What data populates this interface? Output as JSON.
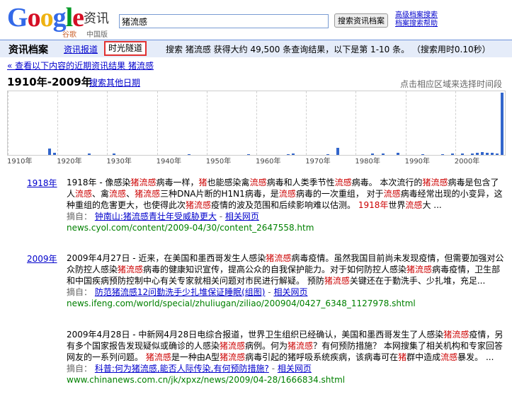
{
  "logo": {
    "text": "Google",
    "cn": "谷歌",
    "region": "中国版"
  },
  "product": "资讯",
  "search": {
    "value": "猪流感",
    "button": "搜索资讯档案",
    "adv1": "高级档案搜索",
    "adv2": "档案搜索帮助"
  },
  "bar": {
    "title": "资讯档案",
    "tab_news": "资讯报道",
    "tab_timeline": "时光隧道",
    "stats": "搜索 猪流感 获得大约 49,500 条查询结果，以下是第 1-10 条。 （搜索用时0.10秒）"
  },
  "back_link": "« 查看以下内容的近期资讯结果 猪流感",
  "range": {
    "label": "1910年-2009年",
    "other": "搜索其他日期",
    "hint": "点击相应区域来选择时间段"
  },
  "chart_data": {
    "type": "bar",
    "x_ticks": [
      "1910年",
      "1920年",
      "1930年",
      "1940年",
      "1950年",
      "1960年",
      "1970年",
      "1980年",
      "1990年",
      "2000年"
    ],
    "bars": [
      {
        "year": 1918,
        "value": 10
      },
      {
        "year": 1919,
        "value": 3
      },
      {
        "year": 1926,
        "value": 2
      },
      {
        "year": 1931,
        "value": 2
      },
      {
        "year": 1946,
        "value": 1
      },
      {
        "year": 1958,
        "value": 1
      },
      {
        "year": 1966,
        "value": 1
      },
      {
        "year": 1967,
        "value": 2
      },
      {
        "year": 1974,
        "value": 1
      },
      {
        "year": 1976,
        "value": 11
      },
      {
        "year": 1983,
        "value": 2
      },
      {
        "year": 1985,
        "value": 2
      },
      {
        "year": 1988,
        "value": 3
      },
      {
        "year": 1993,
        "value": 1
      },
      {
        "year": 1997,
        "value": 1
      },
      {
        "year": 1999,
        "value": 2
      },
      {
        "year": 2001,
        "value": 2
      },
      {
        "year": 2003,
        "value": 2
      },
      {
        "year": 2004,
        "value": 3
      },
      {
        "year": 2005,
        "value": 4
      },
      {
        "year": 2006,
        "value": 3
      },
      {
        "year": 2007,
        "value": 3
      },
      {
        "year": 2008,
        "value": 2
      },
      {
        "year": 2009,
        "value": 100
      }
    ]
  },
  "results": [
    {
      "year": "1918年",
      "segments": [
        {
          "t": "1918年 - 像感染"
        },
        {
          "t": "猪流感",
          "h": true
        },
        {
          "t": "病毒一样，"
        },
        {
          "t": "猪",
          "h": true
        },
        {
          "t": "也能感染禽"
        },
        {
          "t": "流感",
          "h": true
        },
        {
          "t": "病毒和人类季节性"
        },
        {
          "t": "流感",
          "h": true
        },
        {
          "t": "病毒。 本次流行的"
        },
        {
          "t": "猪流感",
          "h": true
        },
        {
          "t": "病毒是包含了人"
        },
        {
          "t": "流感",
          "h": true
        },
        {
          "t": "、禽"
        },
        {
          "t": "流感",
          "h": true
        },
        {
          "t": "、"
        },
        {
          "t": "猪流感",
          "h": true
        },
        {
          "t": "三种DNA片断的H1N1病毒，是"
        },
        {
          "t": "流感",
          "h": true
        },
        {
          "t": "病毒的一次重组， 对于"
        },
        {
          "t": "流感",
          "h": true
        },
        {
          "t": "病毒经常出现的小变异，这种重组的危害更大，也使得此次"
        },
        {
          "t": "猪流感",
          "h": true
        },
        {
          "t": "疫情的波及范围和后续影响难以估测。 "
        },
        {
          "t": "1918年",
          "h": true
        },
        {
          "t": "世界"
        },
        {
          "t": "流感",
          "h": true
        },
        {
          "t": "大 ..."
        }
      ],
      "excerpt_label": "摘自：",
      "excerpt_link": "钟南山:猪流感青壮年受威胁更大",
      "related": "相关网页",
      "url": "news.cyol.com/content/2009-04/30/content_2647558.htm"
    },
    {
      "year": "2009年",
      "segments": [
        {
          "t": "2009年4月27日 - 近来，在美国和墨西哥发生人感染"
        },
        {
          "t": "猪流感",
          "h": true
        },
        {
          "t": "病毒疫情。虽然我国目前尚未发现疫情，但需要加强对公众防控人感染"
        },
        {
          "t": "猪流感",
          "h": true
        },
        {
          "t": "病毒的健康知识宣传，提高公众的自我保护能力。对于如何防控人感染"
        },
        {
          "t": "猪流感",
          "h": true
        },
        {
          "t": "病毒疫情，卫生部和中国疾病预防控制中心有关专家就相关问题对市民进行解疑。 预防"
        },
        {
          "t": "猪流感",
          "h": true
        },
        {
          "t": "关键还在于勤洗手、少扎堆，充足..."
        }
      ],
      "excerpt_label": "摘自：",
      "excerpt_link": "防范猪流感12问勤洗手少扎堆保证睡眠(组图)",
      "related": "相关网页",
      "url": "news.ifeng.com/world/special/zhuliugan/ziliao/200904/0427_6348_1127978.shtml"
    },
    {
      "year": "",
      "segments": [
        {
          "t": "2009年4月28日 - 中新网4月28日电综合报道，世界卫生组织已经确认，美国和墨西哥发生了人感染"
        },
        {
          "t": "猪流感",
          "h": true
        },
        {
          "t": "疫情，另有多个国家报告发现疑似或确诊的人感染"
        },
        {
          "t": "猪流感",
          "h": true
        },
        {
          "t": "病例。何为"
        },
        {
          "t": "猪流感",
          "h": true
        },
        {
          "t": "？有何预防措施？ 本网搜集了相关机构和专家回答网友的一系列问题。 "
        },
        {
          "t": "猪流感",
          "h": true
        },
        {
          "t": "是一种由A型"
        },
        {
          "t": "猪流感",
          "h": true
        },
        {
          "t": "病毒引起的猪呼吸系统疾病，该病毒可在"
        },
        {
          "t": "猪",
          "h": true
        },
        {
          "t": "群中造成"
        },
        {
          "t": "流感",
          "h": true
        },
        {
          "t": "暴发。 ..."
        }
      ],
      "excerpt_label": "摘自：",
      "excerpt_link": "科普:何为猪流感,能否人际传染,有何预防措施?",
      "related": "相关网页",
      "url": "www.chinanews.com.cn/jk/xpxz/news/2009/04-28/1666834.shtml"
    }
  ]
}
